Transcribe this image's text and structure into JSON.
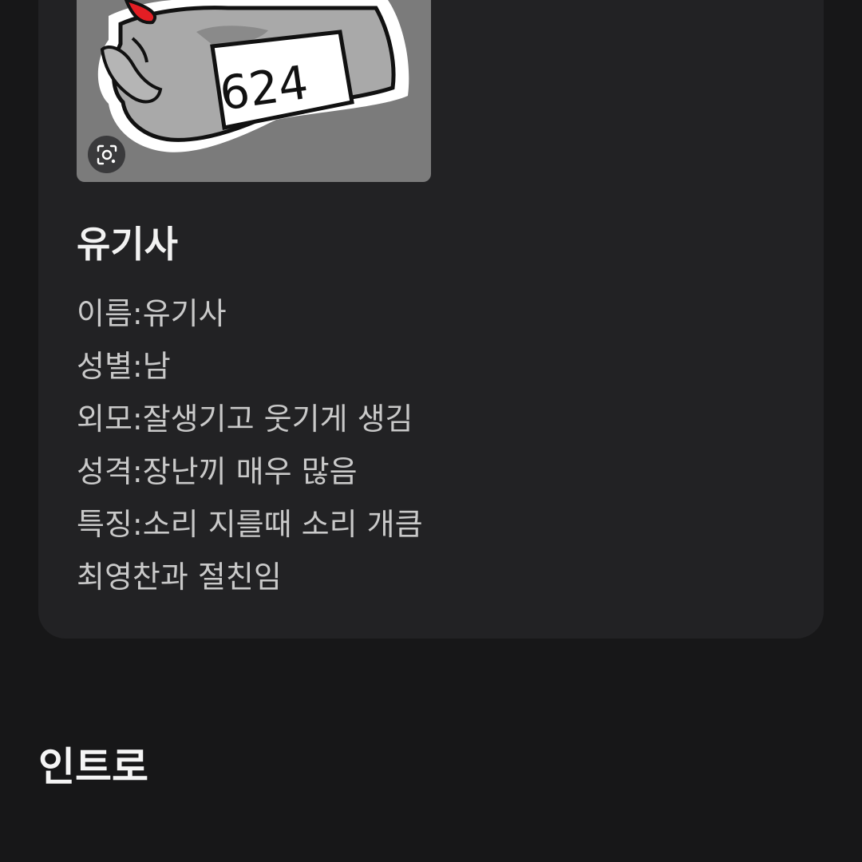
{
  "profile": {
    "image": {
      "sign_text": "624",
      "lens_button_icon": "visual-search-icon"
    },
    "name": "유기사",
    "details": [
      "이름:유기사",
      "성별:남",
      "외모:잘생기고 웃기게 생김",
      "성격:장난끼 매우 많음",
      "특징:소리 지를때 소리 개큼",
      "최영찬과 절친임"
    ]
  },
  "sections": {
    "intro_title": "인트로"
  },
  "colors": {
    "background": "#171718",
    "card": "#222224",
    "image_bg": "#7b7b7b",
    "text_primary": "#f2f2f2",
    "text_secondary": "#c9c9c9"
  }
}
